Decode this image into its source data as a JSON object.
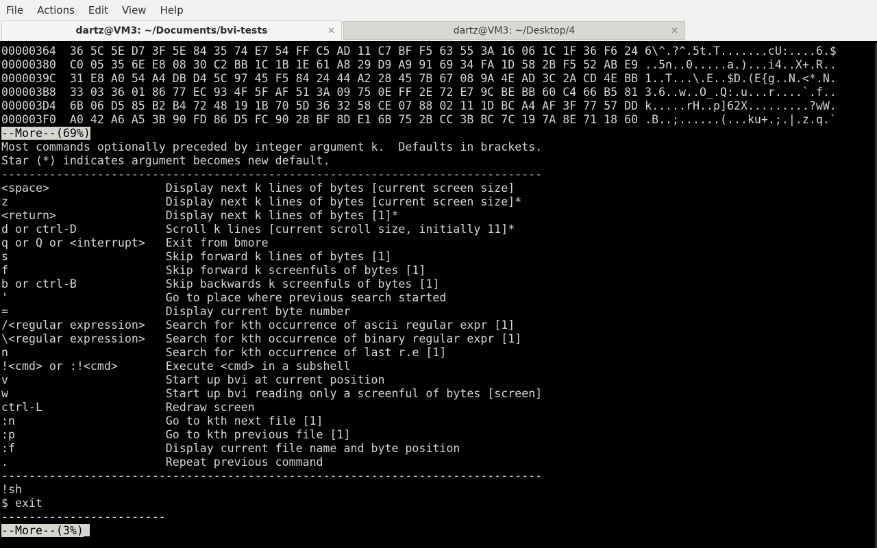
{
  "menubar": {
    "items": [
      "File",
      "Actions",
      "Edit",
      "View",
      "Help"
    ]
  },
  "tabs": [
    {
      "title": "dartz@VM3: ~/Documents/bvi-tests",
      "active": true,
      "close": "×"
    },
    {
      "title": "dartz@VM3: ~/Desktop/4",
      "active": false,
      "close": "×"
    }
  ],
  "terminal": {
    "lines": [
      "00000364  36 5C 5E D7 3F 5E 84 35 74 E7 54 FF C5 AD 11 C7 BF F5 63 55 3A 16 06 1C 1F 36 F6 24 6\\^.?^.5t.T.......cU:....6.$",
      "00000380  C0 05 35 6E E8 08 30 C2 BB 1C 1B 1E 61 A8 29 D9 A9 91 69 34 FA 1D 58 2B F5 52 AB E9 ..5n..0.....a.)...i4..X+.R..",
      "0000039C  31 E8 A0 54 A4 DB D4 5C 97 45 F5 84 24 44 A2 28 45 7B 67 08 9A 4E AD 3C 2A CD 4E BB 1..T...\\.E..$D.(E{g..N.<*.N.",
      "000003B8  33 03 36 01 86 77 EC 93 4F 5F AF 51 3A 09 75 0E FF 2E 72 E7 9C BE BB 60 C4 66 B5 81 3.6..w..O_.Q:.u...r....`.f..",
      "000003D4  6B 06 D5 85 B2 B4 72 48 19 1B 70 5D 36 32 58 CE 07 88 02 11 1D BC A4 AF 3F 77 57 DD k.....rH..p]62X.........?wW.",
      "000003F0  A0 42 A6 A5 3B 90 FD 86 D5 FC 90 28 BF 8D E1 6B 75 2B CC 3B BC 7C 19 7A 8E 71 18 60 .B..;......(...ku+.;.|.z.q.`",
      "--More--(69%)",
      "Most commands optionally preceded by integer argument k.  Defaults in brackets.",
      "Star (*) indicates argument becomes new default.",
      "-------------------------------------------------------------------------------",
      "<space>                 Display next k lines of bytes [current screen size]",
      "z                       Display next k lines of bytes [current screen size]*",
      "<return>                Display next k lines of bytes [1]*",
      "d or ctrl-D             Scroll k lines [current scroll size, initially 11]*",
      "q or Q or <interrupt>   Exit from bmore",
      "s                       Skip forward k lines of bytes [1]",
      "f                       Skip forward k screenfuls of bytes [1]",
      "b or ctrl-B             Skip backwards k screenfuls of bytes [1]",
      "'                       Go to place where previous search started",
      "=                       Display current byte number",
      "/<regular expression>   Search for kth occurrence of ascii regular expr [1]",
      "\\<regular expression>   Search for kth occurrence of binary regular expr [1]",
      "n                       Search for kth occurrence of last r.e [1]",
      "!<cmd> or :!<cmd>       Execute <cmd> in a subshell",
      "v                       Start up bvi at current position",
      "w                       Start up bvi reading only a screenful of bytes [screen]",
      "ctrl-L                  Redraw screen",
      ":n                      Go to kth next file [1]",
      ":p                      Go to kth previous file [1]",
      ":f                      Display current file name and byte position",
      ".                       Repeat previous command",
      "-------------------------------------------------------------------------------",
      "!sh",
      "$ exit",
      "------------------------",
      "--More--(3%)"
    ],
    "more_prompts": [
      "--More--(69%)",
      "--More--(3%)"
    ],
    "colors": {
      "foreground": "#d3d7cf",
      "background": "#000000"
    }
  }
}
